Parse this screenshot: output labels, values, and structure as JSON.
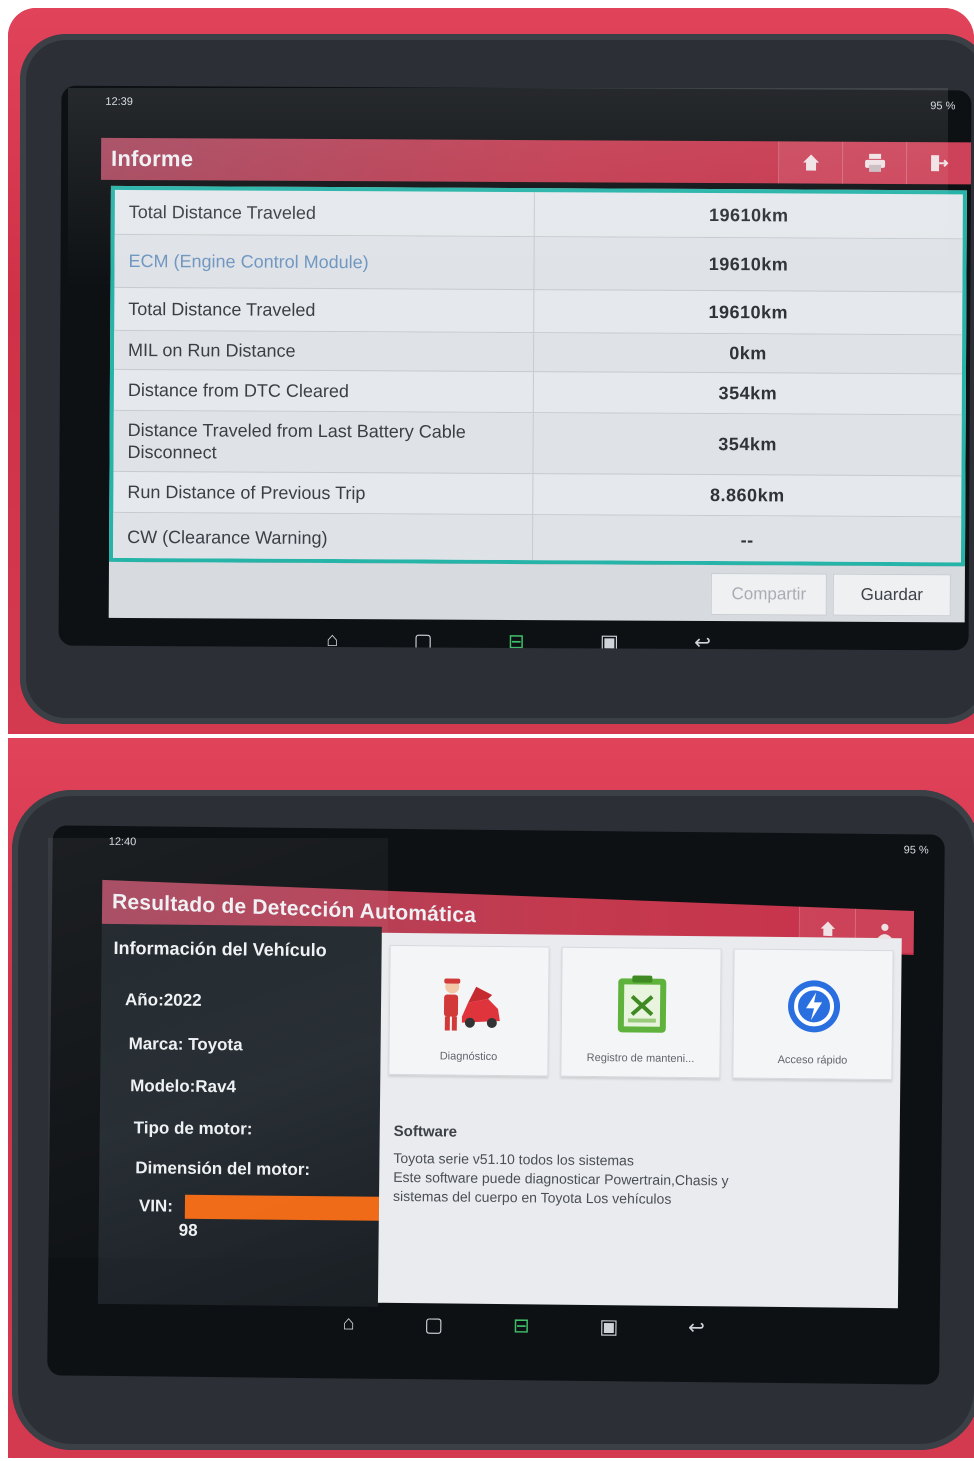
{
  "screen1": {
    "status": {
      "left": "12:39",
      "right": "95 %"
    },
    "title": "Informe",
    "rows": [
      {
        "label": "Total Distance Traveled",
        "value": "19610km"
      },
      {
        "label": "ECM (Engine Control Module)",
        "value": "19610km"
      },
      {
        "label": "Total Distance Traveled",
        "value": "19610km"
      },
      {
        "label": "MIL on Run Distance",
        "value": "0km"
      },
      {
        "label": "Distance from DTC Cleared",
        "value": "354km"
      },
      {
        "label": "Distance Traveled from Last Battery Cable Disconnect",
        "value": "354km"
      },
      {
        "label": "Run Distance of Previous Trip",
        "value": "8.860km"
      },
      {
        "label": "CW (Clearance Warning)",
        "value": "--"
      }
    ],
    "buttons": {
      "share": "Compartir",
      "save": "Guardar"
    }
  },
  "screen2": {
    "status": {
      "left": "12:40",
      "right": "95 %"
    },
    "title": "Resultado de Detección Automática",
    "vehicle": {
      "heading": "Información del Vehículo",
      "year": "Año:2022",
      "make": "Marca: Toyota",
      "model": "Modelo:Rav4",
      "engine_type": "Tipo de motor:",
      "engine_size": "Dimensión del motor:",
      "vin_label": "VIN:",
      "vin_tail": "98"
    },
    "cards": [
      {
        "label": "Diagnóstico",
        "icon": "mechanic-car-icon"
      },
      {
        "label": "Registro de manteni...",
        "icon": "maintenance-clipboard-icon"
      },
      {
        "label": "Acceso rápido",
        "icon": "quick-access-icon"
      }
    ],
    "software": {
      "heading": "Software",
      "line1": "Toyota serie v51.10 todos los sistemas",
      "line2": "Este software puede diagnosticar Powertrain,Chasis y",
      "line3": "sistemas del cuerpo en Toyota Los vehículos"
    }
  },
  "colors": {
    "case_red": "#d33a50",
    "title_red": "#c33a4f",
    "teal_border": "#26b3a8",
    "vin_mask": "#f06a16",
    "nav_active": "#3fbf6a"
  }
}
